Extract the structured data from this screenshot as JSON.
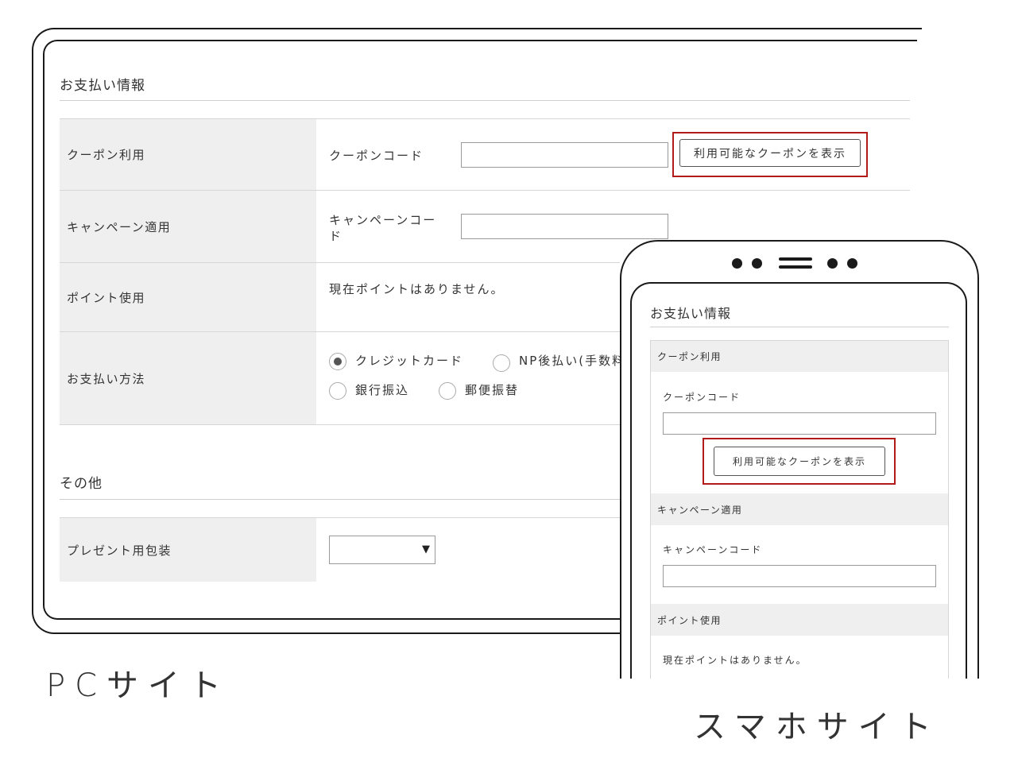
{
  "pc": {
    "payment_section_title": "お支払い情報",
    "rows": {
      "coupon": {
        "label": "クーポン利用",
        "field_label": "クーポンコード",
        "input_value": "",
        "button_label": "利用可能なクーポンを表示"
      },
      "campaign": {
        "label": "キャンペーン適用",
        "field_label_line1": "キャンペーンコー",
        "field_label_line2": "ド",
        "input_value": ""
      },
      "points": {
        "label": "ポイント使用",
        "text": "現在ポイントはありません。"
      },
      "payment_method": {
        "label": "お支払い方法",
        "options": [
          {
            "label": "クレジットカード",
            "selected": true
          },
          {
            "label": "NP後払い(手数料",
            "selected": false
          },
          {
            "label": "銀行振込",
            "selected": false
          },
          {
            "label": "郵便振替",
            "selected": false
          }
        ]
      }
    },
    "other_section_title": "その他",
    "gift_wrap": {
      "label": "プレゼント用包装",
      "selected_value": "",
      "arrow": "▼"
    },
    "caption": "PCサイト"
  },
  "sp": {
    "payment_section_title": "お支払い情報",
    "coupon": {
      "header": "クーポン利用",
      "field_label": "クーポンコード",
      "input_value": "",
      "button_label": "利用可能なクーポンを表示"
    },
    "campaign": {
      "header": "キャンペーン適用",
      "field_label": "キャンペーンコード",
      "input_value": ""
    },
    "points": {
      "header": "ポイント使用",
      "text": "現在ポイントはありません。"
    },
    "caption": "スマホサイト"
  },
  "colors": {
    "highlight": "#b31b1b",
    "label_bg": "#efefef",
    "frame": "#1a1a1a"
  }
}
